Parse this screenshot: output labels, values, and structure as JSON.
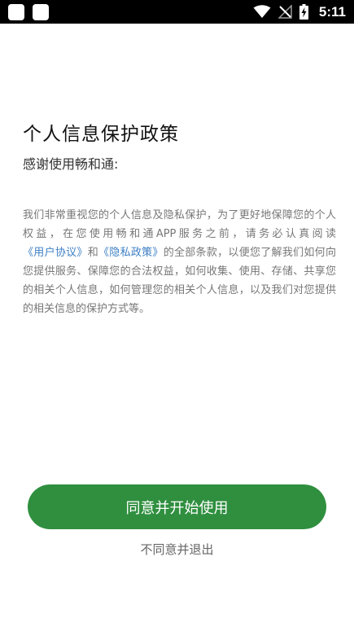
{
  "status_bar": {
    "time": "5:11",
    "icons": [
      "notification-square-icon",
      "notification-square-icon",
      "wifi-icon",
      "no-signal-icon",
      "battery-charging-icon"
    ],
    "background": "#000000"
  },
  "dialog": {
    "title": "个人信息保护政策",
    "greeting": "感谢使用畅和通:",
    "body_part1": "我们非常重视您的个人信息及隐私保护，为了更好地保障您的个人权益，在您使用畅和通APP服务之前，请务必认真阅读",
    "user_agreement_link": "《用户协议》",
    "conjunction": "和",
    "privacy_policy_link": "《隐私政策》",
    "body_part2": "的全部条款，以便您了解我们如何向您提供服务、保障您的合法权益，如何收集、使用、存储、共享您的相关个人信息，如何管理您的相关个人信息，以及我们对您提供的相关信息的保护方式等。",
    "agree_button": "同意并开始使用",
    "disagree_button": "不同意并退出"
  },
  "colors": {
    "accent_green": "#2f8f3f",
    "link_blue": "#3d7fc4",
    "body_text": "#777777"
  }
}
